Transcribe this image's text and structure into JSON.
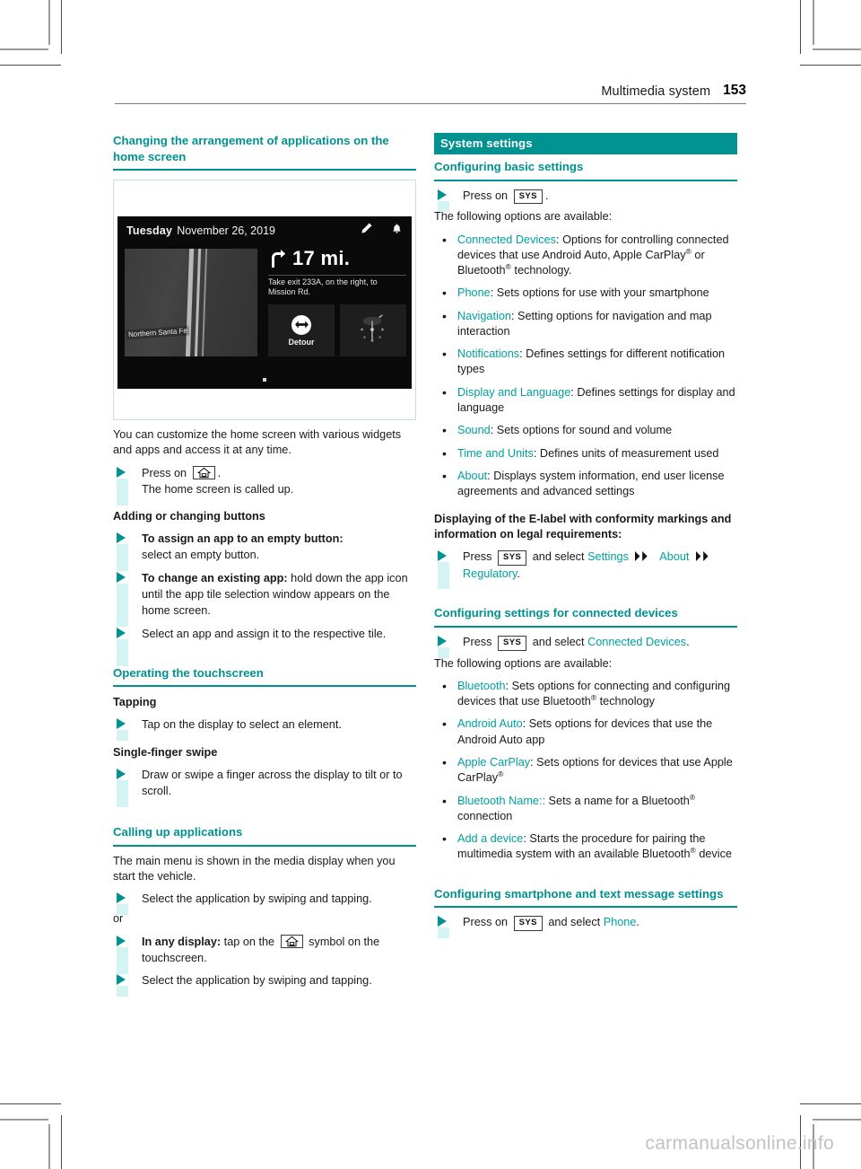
{
  "header": {
    "title": "Multimedia system",
    "page_number": "153"
  },
  "left_column": {
    "heading": "Changing the arrangement of applications on the home screen",
    "figure": {
      "day": "Tuesday",
      "date": "November 26, 2019",
      "distance": "17 mi.",
      "instruction": "Take exit 233A, on the right, to Mission Rd.",
      "map_label": "Northern Santa Fe",
      "detour_label": "Detour"
    },
    "intro": "You can customize the home screen with various widgets and apps and access it at any time.",
    "step_press_home_pre": "Press on",
    "step_press_home_post": ".",
    "step_press_home_result": "The home screen is called up.",
    "subheading_adding": "Adding or changing buttons",
    "step_assign_bold": "To assign an app to an empty button:",
    "step_assign_rest": "select an empty button.",
    "step_change_bold": "To change an existing app:",
    "step_change_rest": "hold down the app icon until the app tile selection window appears on the home screen.",
    "step_select_tile": "Select an app and assign it to the respective tile.",
    "heading_touchscreen": "Operating the touchscreen",
    "sub_tapping": "Tapping",
    "step_tap": "Tap on the display to select an element.",
    "sub_swipe": "Single-finger swipe",
    "step_swipe": "Draw or swipe a finger across the display to tilt or to scroll.",
    "heading_calling": "Calling up applications",
    "calling_intro": "The main menu is shown in the media display when you start the vehicle.",
    "step_select_app_1": "Select the application by swiping and tapping.",
    "or_label": "or",
    "step_any_display_bold": "In any display:",
    "step_any_display_mid": "tap on the",
    "step_any_display_end": "symbol on the touchscreen.",
    "step_select_app_2": "Select the application by swiping and tapping."
  },
  "right_column": {
    "bar_heading": "System settings",
    "heading_basic": "Configuring basic settings",
    "step_press_pre": "Press on",
    "key_sys": "SYS",
    "step_press_post": ".",
    "following_options": "The following options are available:",
    "basic_options": [
      {
        "menu": "Connected Devices",
        "text": ": Options for controlling connected devices that use Android Auto, Apple CarPlay® or Bluetooth® technology."
      },
      {
        "menu": "Phone",
        "text": ": Sets options for use with your smartphone"
      },
      {
        "menu": "Navigation",
        "text": ": Setting options for navigation and map interaction"
      },
      {
        "menu": "Notifications",
        "text": ": Defines settings for different notification types"
      },
      {
        "menu": "Display and Language",
        "text": ": Defines settings for display and language"
      },
      {
        "menu": "Sound",
        "text": ": Sets options for sound and volume"
      },
      {
        "menu": "Time and Units",
        "text": ": Defines units of measurement used"
      },
      {
        "menu": "About",
        "text": ": Displays system information, end user license agreements and advanced settings"
      }
    ],
    "elabel_heading": "Displaying of the E-label with conformity markings and information on legal requirements:",
    "elabel_press": "Press",
    "elabel_and_select": "and select",
    "elabel_settings": "Settings",
    "elabel_about": "About",
    "elabel_regulatory": "Regulatory",
    "elabel_period": ".",
    "heading_connected": "Configuring settings for connected devices",
    "connected_press": "Press",
    "connected_and_select": "and select",
    "connected_menu": "Connected Devices",
    "connected_period": ".",
    "connected_following": "The following options are available:",
    "connected_options": [
      {
        "menu": "Bluetooth",
        "text": ": Sets options for connecting and configuring devices that use Bluetooth® technology"
      },
      {
        "menu": "Android Auto",
        "text": ": Sets options for devices that use the Android Auto app"
      },
      {
        "menu": "Apple CarPlay",
        "text": ": Sets options for devices that use Apple CarPlay®"
      },
      {
        "menu": "Bluetooth Name::",
        "text": " Sets a name for a Bluetooth® connection"
      },
      {
        "menu": "Add a device",
        "text": ": Starts the procedure for pairing the multimedia system with an available Bluetooth® device"
      }
    ],
    "heading_smartphone": "Configuring smartphone and text message settings",
    "smartphone_press": "Press on",
    "smartphone_and_select": "and select",
    "smartphone_menu": "Phone",
    "smartphone_period": "."
  },
  "watermark": "carmanualsonline.info",
  "colors": {
    "accent": "#009191",
    "accent_light": "#00a0a0",
    "step_bar": "#d4f3f3"
  }
}
